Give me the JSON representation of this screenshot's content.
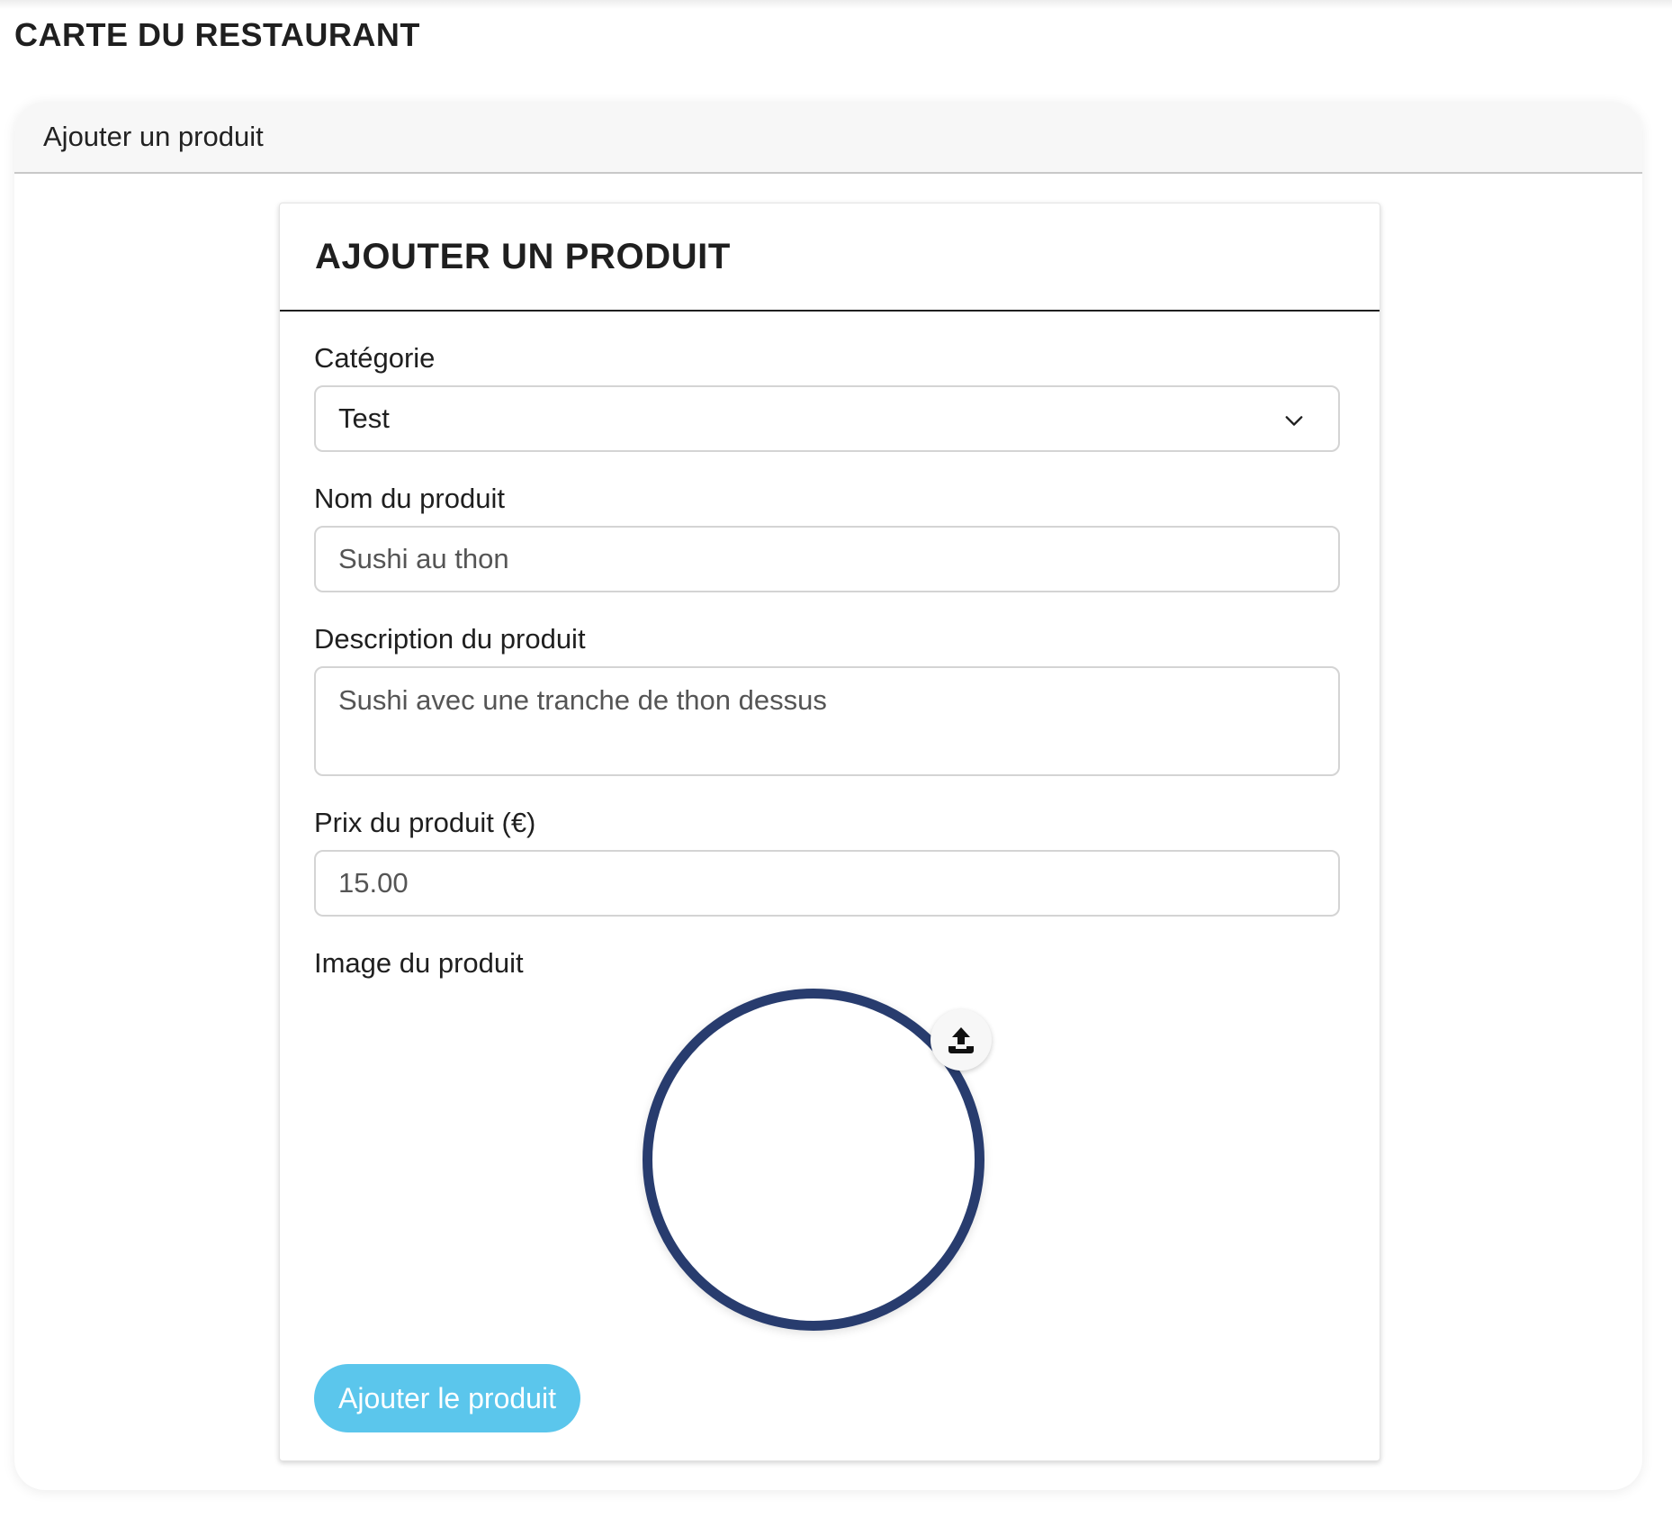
{
  "page": {
    "title": "CARTE DU RESTAURANT"
  },
  "outer_card": {
    "header": "Ajouter un produit"
  },
  "form": {
    "title": "AJOUTER UN PRODUIT",
    "category": {
      "label": "Catégorie",
      "value": "Test"
    },
    "name": {
      "label": "Nom du produit",
      "value": "Sushi au thon"
    },
    "description": {
      "label": "Description du produit",
      "value": "Sushi avec une tranche de thon dessus"
    },
    "price": {
      "label": "Prix du produit (€)",
      "value": "15.00"
    },
    "image": {
      "label": "Image du produit",
      "upload_icon": "upload-icon"
    },
    "submit_label": "Ajouter le produit"
  },
  "colors": {
    "circle_border": "#283c6e",
    "submit_button": "#5bc6ec"
  }
}
